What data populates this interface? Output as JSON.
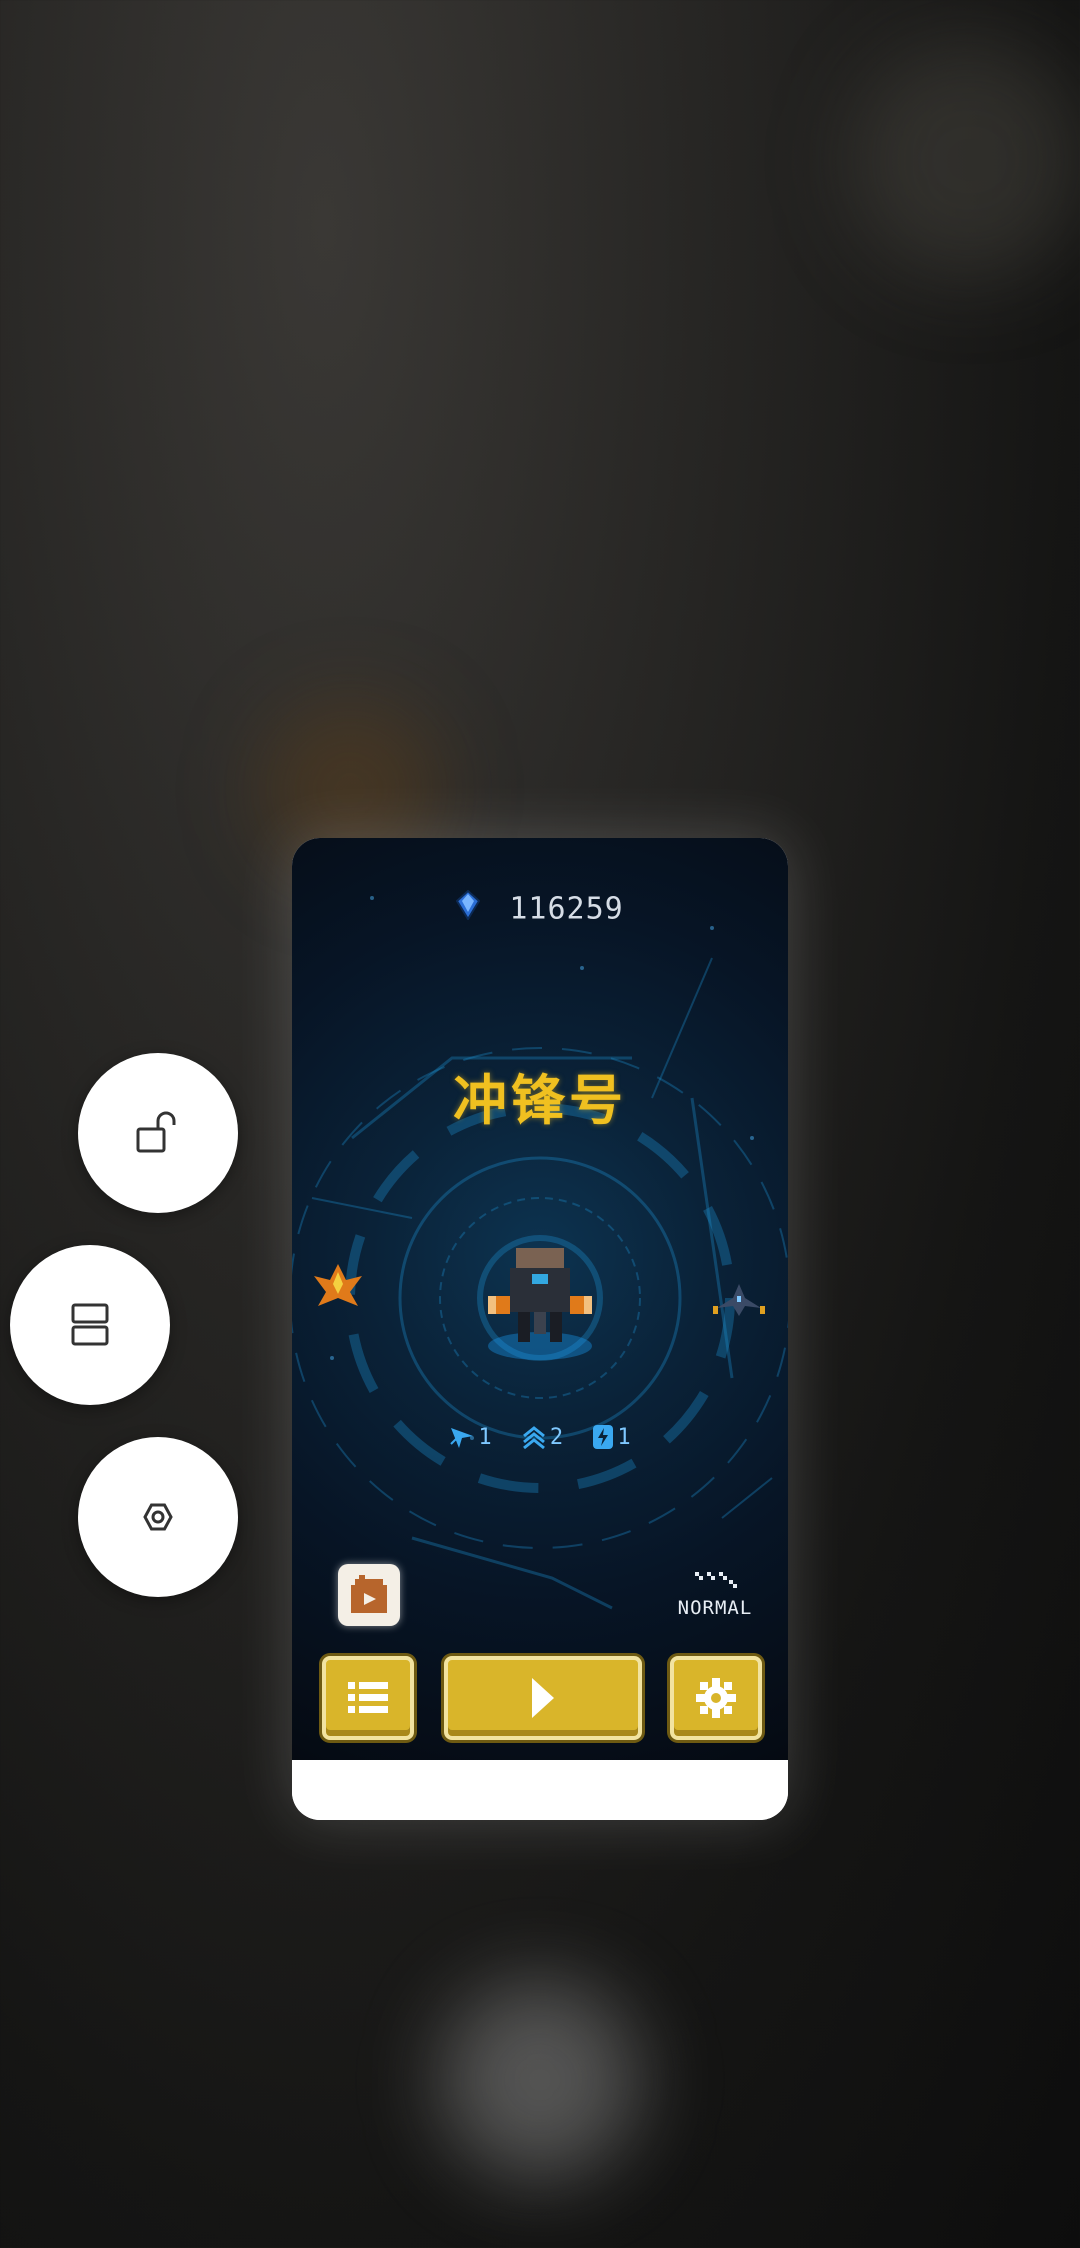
{
  "side_actions": {
    "lock": {
      "icon": "unlock-icon"
    },
    "split": {
      "icon": "split-screen-icon"
    },
    "settings": {
      "icon": "hexagon-settings-icon"
    }
  },
  "game": {
    "currency": {
      "icon": "blue-gem-icon",
      "value": "116259"
    },
    "ship_name": "冲锋号",
    "stats": [
      {
        "icon": "speed-arrow-icon",
        "value": "1"
      },
      {
        "icon": "power-chevron-icon",
        "value": "2"
      },
      {
        "icon": "energy-bolt-icon",
        "value": "1"
      }
    ],
    "difficulty": "NORMAL",
    "buttons": {
      "menu": {
        "icon": "list-icon"
      },
      "play": {
        "icon": "play-icon"
      },
      "settings": {
        "icon": "gear-icon"
      },
      "video": {
        "icon": "video-ad-icon"
      }
    }
  },
  "colors": {
    "title": "#f0c020",
    "button": "#d9b52a",
    "hud_blue": "#1e8ccc"
  }
}
